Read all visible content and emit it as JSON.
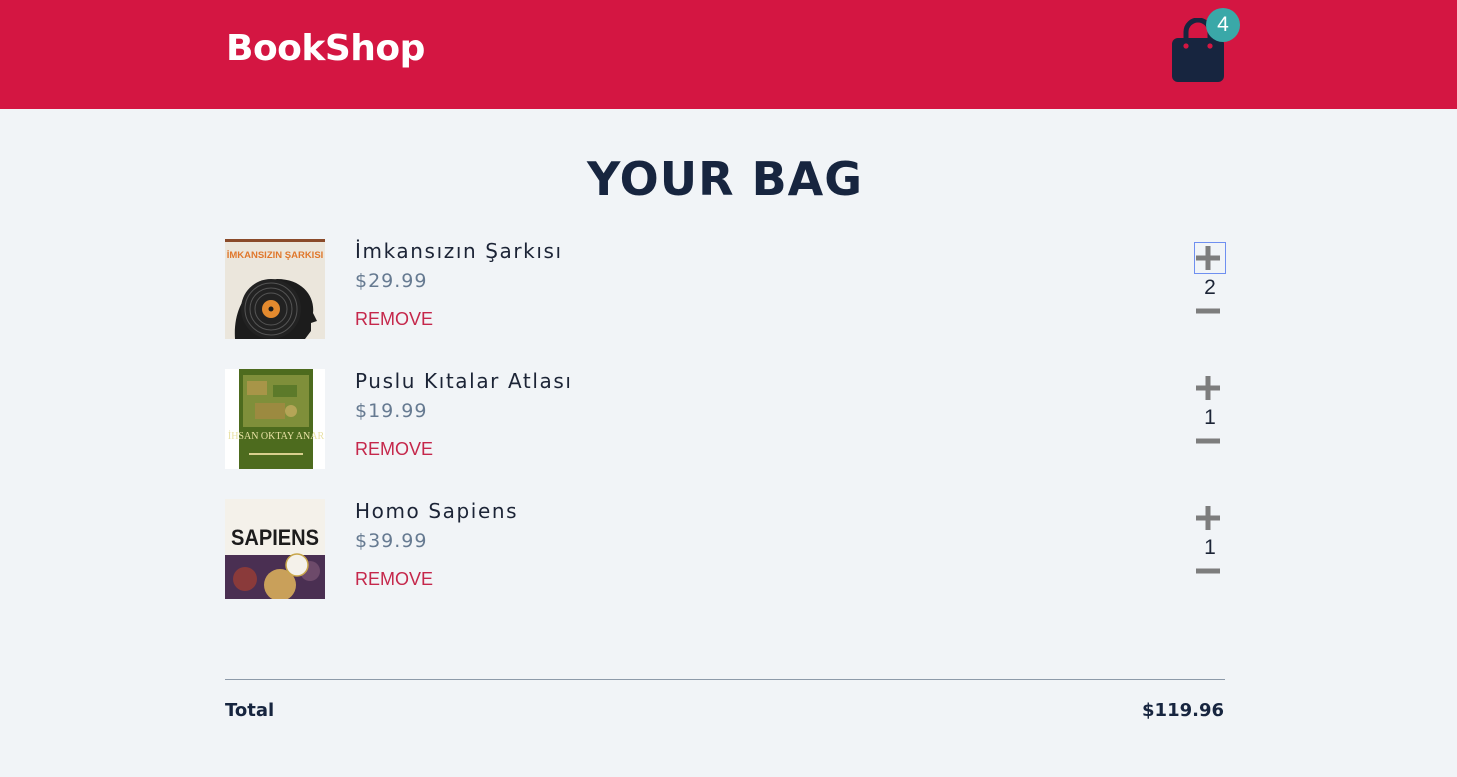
{
  "brand": "BookShop",
  "cart": {
    "icon": "shopping-bag-icon",
    "count": "4"
  },
  "title": "YOUR BAG",
  "items": [
    {
      "name": "İmkansızın Şarkısı",
      "price": "$29.99",
      "remove_label": "REMOVE",
      "quantity": "2",
      "cover_text": "İMKANSIZIN ŞARKISI"
    },
    {
      "name": "Puslu Kıtalar Atlası",
      "price": "$19.99",
      "remove_label": "REMOVE",
      "quantity": "1",
      "cover_text": "İHSAN OKTAY ANAR"
    },
    {
      "name": "Homo Sapiens",
      "price": "$39.99",
      "remove_label": "REMOVE",
      "quantity": "1",
      "cover_text": "SAPIENS"
    }
  ],
  "footer": {
    "total_label": "Total",
    "total_value": "$119.96"
  },
  "colors": {
    "header": "#d41642",
    "navy": "#17253f",
    "remove": "#c5274b",
    "badge": "#3aa8a8",
    "background": "#f1f4f7"
  }
}
